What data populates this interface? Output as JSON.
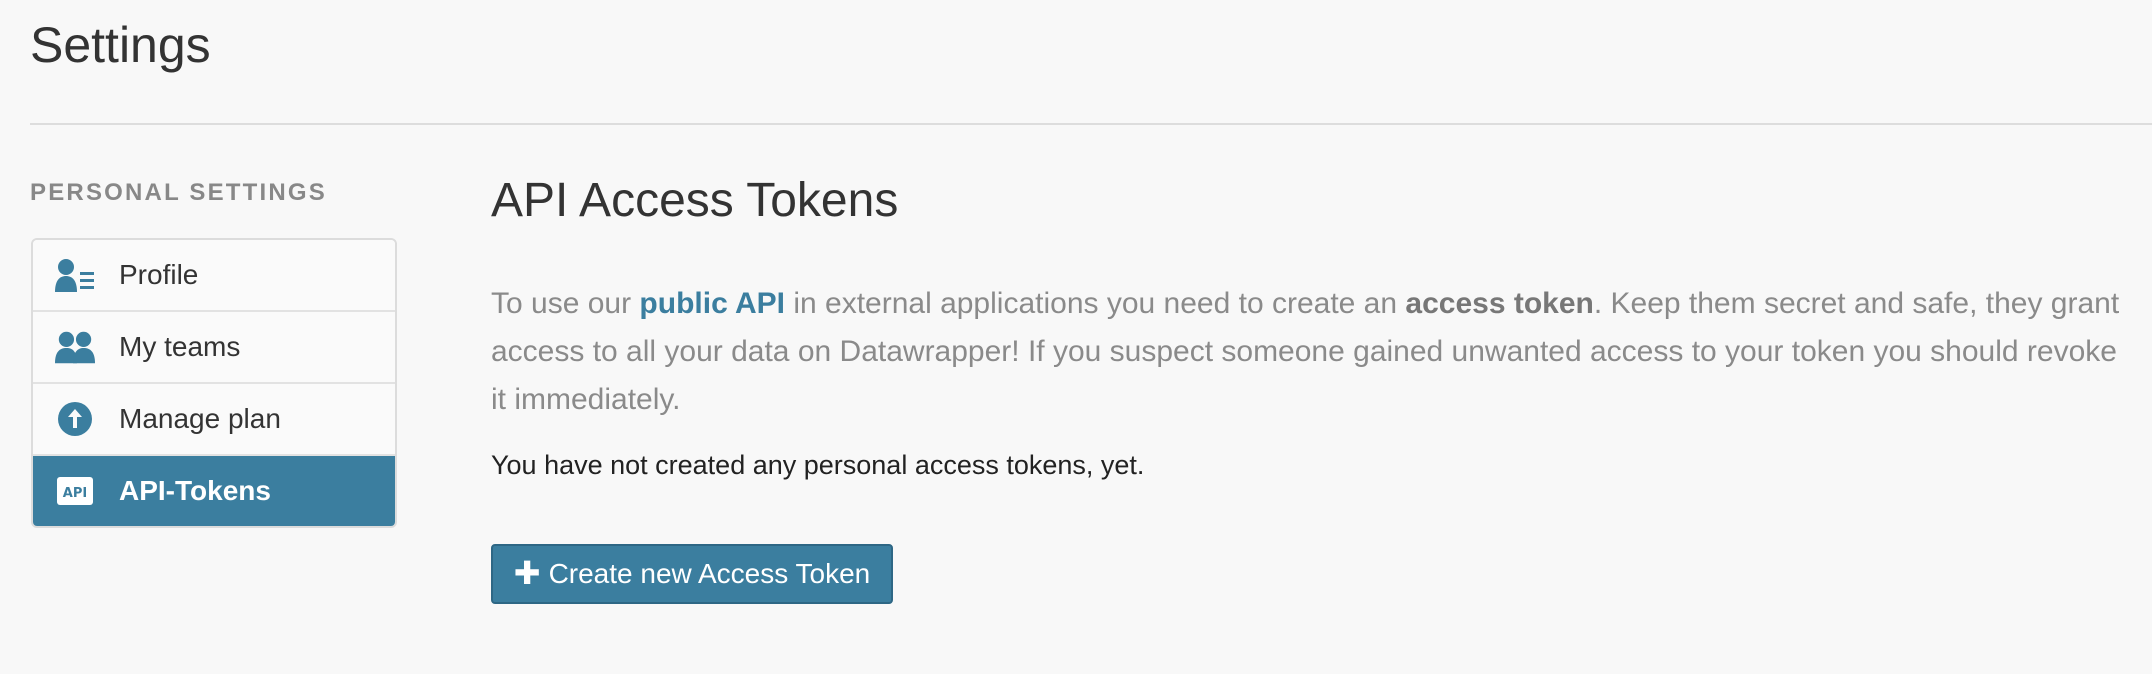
{
  "page": {
    "title": "Settings"
  },
  "sidebar": {
    "heading": "PERSONAL SETTINGS",
    "items": [
      {
        "label": "Profile",
        "icon": "profile-icon",
        "active": false
      },
      {
        "label": "My teams",
        "icon": "teams-icon",
        "active": false
      },
      {
        "label": "Manage plan",
        "icon": "upgrade-arrow-icon",
        "active": false
      },
      {
        "label": "API-Tokens",
        "icon": "api-icon",
        "active": true
      }
    ]
  },
  "main": {
    "heading": "API Access Tokens",
    "intro": {
      "part1": "To use our ",
      "link": "public API",
      "part2": " in external applications you need to create an ",
      "bold": "access token",
      "part3": ". Keep them secret and safe, they grant access to all your data on Datawrapper! If you suspect someone gained unwanted access to your token you should revoke it immediately."
    },
    "notice": "You have not created any personal access tokens, yet.",
    "create_button": {
      "icon": "plus-icon",
      "label": "Create new Access Token"
    }
  },
  "colors": {
    "accent": "#3b7e9f",
    "background": "#f8f8f8",
    "muted_text": "#8a8a8a"
  }
}
